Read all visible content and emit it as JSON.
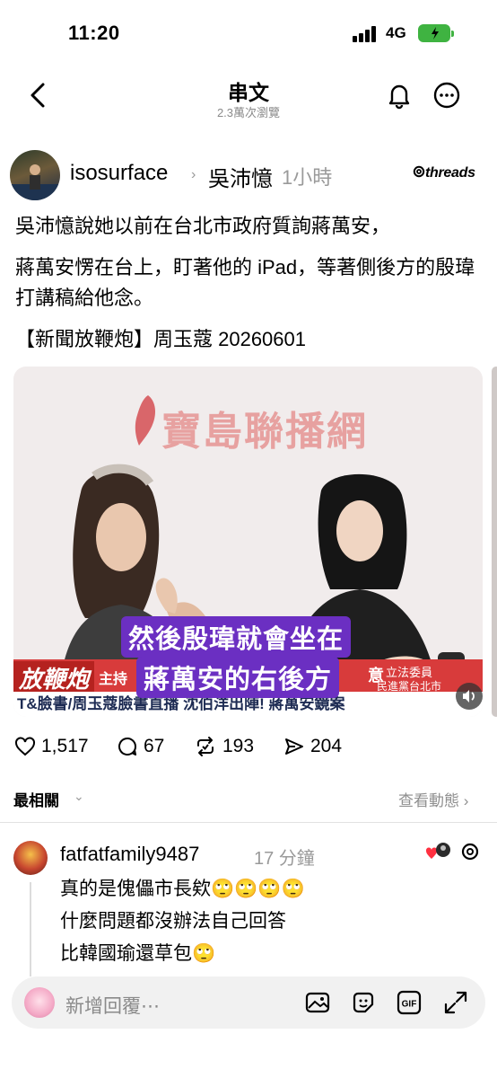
{
  "status_bar": {
    "time": "11:20",
    "network": "4G"
  },
  "header": {
    "title": "串文",
    "subtitle": "2.3萬次瀏覽"
  },
  "post": {
    "username": "isosurface",
    "mention": "吳沛憶",
    "time": "1小時",
    "brand": "threads",
    "paragraphs": [
      "吳沛憶說她以前在台北市政府質詢蔣萬安，",
      "蔣萬安愣在台上，盯著他的 iPad，等著側後方的殷瑋打講稿給他念。",
      "【新聞放鞭炮】周玉蔻 20260601"
    ],
    "video": {
      "station_name": "寶島聯播網",
      "caption_line1": "然後殷瑋就會坐在",
      "caption_line2": "蔣萬安的右後方",
      "show_name": "放鞭炮",
      "host_label": "主持",
      "right_title1": "立法委員",
      "right_title2": "民進黨台北市",
      "ticker": "T&臉書/周玉蔻臉書直播 沈伯洋出陣! 蔣萬安鏡案",
      "caption_tail": "意"
    },
    "stats": {
      "likes": "1,517",
      "comments": "67",
      "reposts": "193",
      "shares": "204"
    }
  },
  "sort": {
    "label": "最相關",
    "activity": "查看動態"
  },
  "reply": {
    "username": "fatfatfamily9487",
    "time": "17 分鐘",
    "lines": [
      "真的是傀儡市長欸🙄🙄🙄🙄",
      "什麼問題都沒辦法自己回答",
      "比韓國瑜還草包🙄"
    ]
  },
  "compose": {
    "placeholder": "新增回覆⋯"
  },
  "icons": {
    "back": "chevron-left-icon",
    "bell": "bell-icon",
    "more": "more-icon",
    "like": "heart-icon",
    "comment": "comment-icon",
    "repost": "repost-icon",
    "share": "send-icon",
    "image": "image-icon",
    "sticker": "sticker-icon",
    "gif": "gif-icon",
    "expand": "expand-icon"
  },
  "colors": {
    "caption_bg": "#6b2fc2",
    "accent_red": "#d83b3b",
    "battery": "#3fb341"
  }
}
